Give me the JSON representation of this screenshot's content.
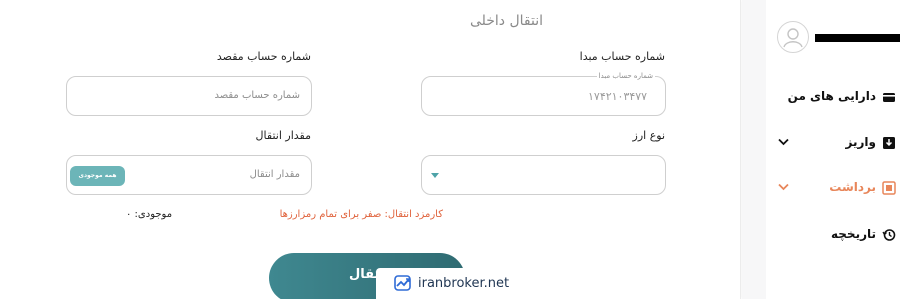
{
  "page_title": "انتقال داخلی",
  "form": {
    "source_label": "شماره حساب مبدا",
    "source_float_label": "شماره حساب مبدا",
    "source_value": "۱۷۴۲۱۰۳۴۷۷",
    "dest_label": "شماره حساب مقصد",
    "dest_placeholder": "شماره حساب مقصد",
    "currency_label": "نوع ارز",
    "amount_label": "مقدار انتقال",
    "amount_placeholder": "مقدار انتقال",
    "all_button": "همه موجودی",
    "fee_text": "کارمزد انتقال: صفر برای تمام رمزارزها",
    "available_text": "موجودی: ۰",
    "submit_label": "انتقال"
  },
  "watermark": {
    "text": "iranbroker.net",
    "icon": "trend-arrow-icon"
  },
  "sidebar": {
    "items": [
      {
        "label": "دارایی های من",
        "icon": "wallet-icon"
      },
      {
        "label": "واریز",
        "icon": "deposit-icon",
        "chevron": "chevron-down-icon"
      },
      {
        "label": "برداشت",
        "icon": "withdraw-icon",
        "chevron": "chevron-down-icon",
        "active": true
      },
      {
        "label": "تاریخچه",
        "icon": "history-icon"
      }
    ]
  },
  "colors": {
    "accent": "#4ea3a8",
    "active": "#e8865a",
    "fee": "#e0623b",
    "button_dark": "#2f6b72"
  }
}
